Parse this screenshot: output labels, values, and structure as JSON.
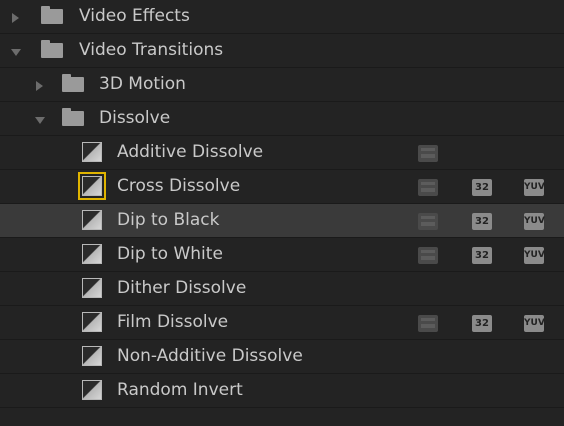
{
  "effects_panel": {
    "rows": [
      {
        "label": "Video Effects",
        "type": "folder",
        "expanded": false
      },
      {
        "label": "Video Transitions",
        "type": "folder",
        "expanded": true
      },
      {
        "label": "3D Motion",
        "type": "folder",
        "expanded": false
      },
      {
        "label": "Dissolve",
        "type": "folder",
        "expanded": true
      },
      {
        "label": "Additive Dissolve",
        "type": "transition",
        "badges": [
          "accelerated"
        ]
      },
      {
        "label": "Cross Dissolve",
        "type": "transition",
        "badges": [
          "accelerated",
          "32",
          "yuv"
        ],
        "focused": true
      },
      {
        "label": "Dip to Black",
        "type": "transition",
        "badges": [
          "accelerated",
          "32",
          "yuv"
        ],
        "highlighted": true
      },
      {
        "label": "Dip to White",
        "type": "transition",
        "badges": [
          "accelerated",
          "32",
          "yuv"
        ]
      },
      {
        "label": "Dither Dissolve",
        "type": "transition",
        "badges": []
      },
      {
        "label": "Film Dissolve",
        "type": "transition",
        "badges": [
          "accelerated",
          "32",
          "yuv"
        ]
      },
      {
        "label": "Non-Additive Dissolve",
        "type": "transition",
        "badges": []
      },
      {
        "label": "Random Invert",
        "type": "transition",
        "badges": []
      }
    ],
    "badge_text": {
      "b32": "32",
      "yuv": "YUV"
    }
  },
  "colors": {
    "background": "#232323",
    "highlight_row": "#3a3a3a",
    "focus_outline": "#e0b400",
    "text": "#c9c9c9"
  }
}
